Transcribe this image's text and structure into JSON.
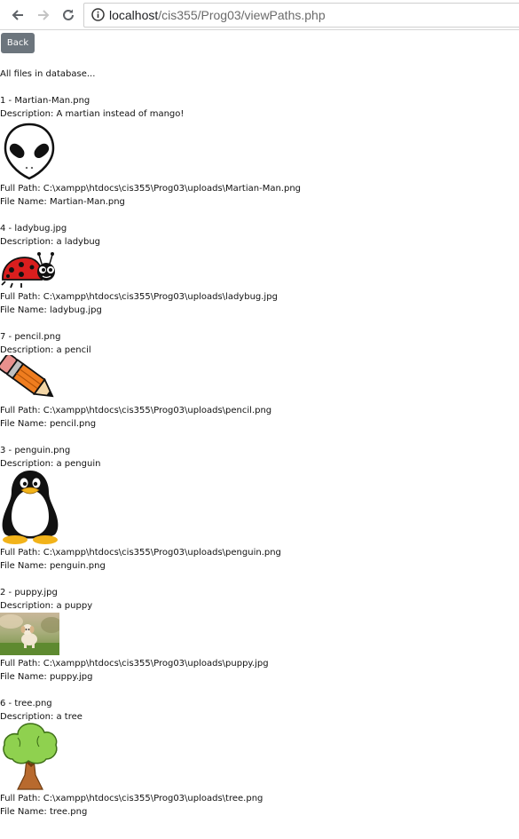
{
  "browser": {
    "url_host": "localhost",
    "url_path": "/cis355/Prog03/viewPaths.php"
  },
  "page": {
    "back_label": "Back",
    "intro": "All files in database...",
    "files": [
      {
        "heading": "1 - Martian-Man.png",
        "description": "Description: A martian instead of mango!",
        "full_path": "Full Path: C:\\xampp\\htdocs\\cis355\\Prog03\\uploads\\Martian-Man.png",
        "file_name": "File Name: Martian-Man.png",
        "image": "alien-head-image"
      },
      {
        "heading": "4 - ladybug.jpg",
        "description": "Description: a ladybug",
        "full_path": "Full Path: C:\\xampp\\htdocs\\cis355\\Prog03\\uploads\\ladybug.jpg",
        "file_name": "File Name: ladybug.jpg",
        "image": "ladybug-image"
      },
      {
        "heading": "7 - pencil.png",
        "description": "Description: a pencil",
        "full_path": "Full Path: C:\\xampp\\htdocs\\cis355\\Prog03\\uploads\\pencil.png",
        "file_name": "File Name: pencil.png",
        "image": "pencil-image"
      },
      {
        "heading": "3 - penguin.png",
        "description": "Description: a penguin",
        "full_path": "Full Path: C:\\xampp\\htdocs\\cis355\\Prog03\\uploads\\penguin.png",
        "file_name": "File Name: penguin.png",
        "image": "penguin-image"
      },
      {
        "heading": "2 - puppy.jpg",
        "description": "Description: a puppy",
        "full_path": "Full Path: C:\\xampp\\htdocs\\cis355\\Prog03\\uploads\\puppy.jpg",
        "file_name": "File Name: puppy.jpg",
        "image": "puppy-photo-image"
      },
      {
        "heading": "6 - tree.png",
        "description": "Description: a tree",
        "full_path": "Full Path: C:\\xampp\\htdocs\\cis355\\Prog03\\uploads\\tree.png",
        "file_name": "File Name: tree.png",
        "image": "tree-image"
      }
    ]
  },
  "colors": {
    "button_bg": "#6c757d",
    "button_text": "#ffffff",
    "url_path": "#6b6b6b"
  }
}
